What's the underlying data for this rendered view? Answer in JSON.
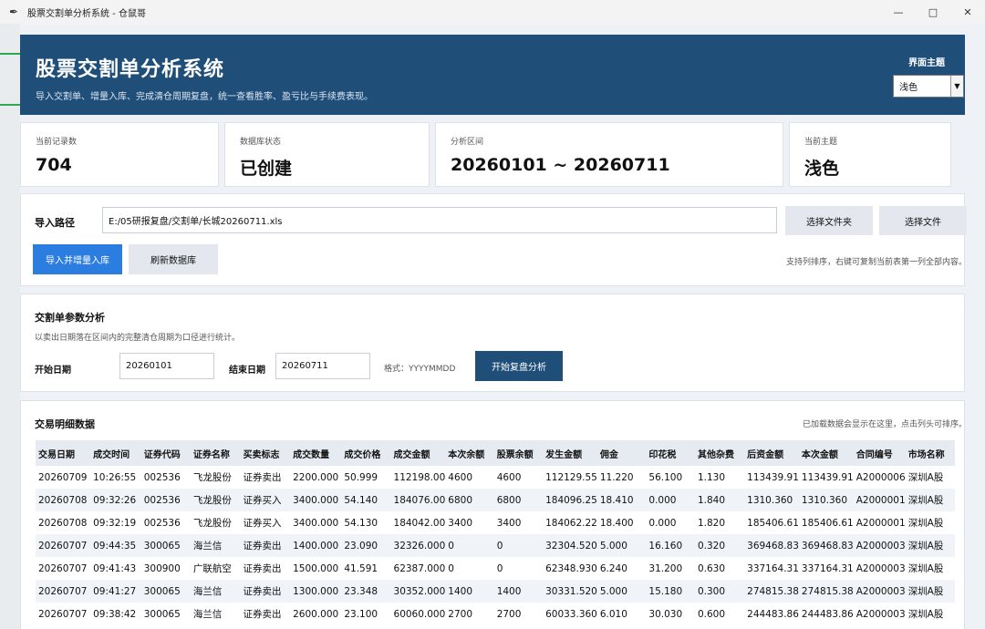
{
  "window": {
    "title": "股票交割单分析系统 - 仓鼠哥",
    "controls": [
      "minimize",
      "maximize",
      "close"
    ]
  },
  "header": {
    "title": "股票交割单分析系统",
    "subtitle": "导入交割单、增量入库、完成清仓周期复盘，统一查看胜率、盈亏比与手续费表现。",
    "theme_label": "界面主题",
    "theme_value": "浅色"
  },
  "stats": [
    {
      "label": "当前记录数",
      "value": "704"
    },
    {
      "label": "数据库状态",
      "value": "已创建"
    },
    {
      "label": "分析区间",
      "value": "20260101 ~ 20260711"
    },
    {
      "label": "当前主题",
      "value": "浅色"
    }
  ],
  "import": {
    "path_label": "导入路径",
    "path_value": "E:/05研报复盘/交割单/长城20260711.xls",
    "choose_folder": "选择文件夹",
    "choose_file": "选择文件",
    "import_button": "导入并增量入库",
    "refresh_button": "刷新数据库",
    "hint": "支持列排序，右键可复制当前表第一列全部内容。"
  },
  "analysis": {
    "title": "交割单参数分析",
    "desc": "以卖出日期落在区间内的完整清仓周期为口径进行统计。",
    "start_label": "开始日期",
    "start_value": "20260101",
    "end_label": "结束日期",
    "end_value": "20260711",
    "format_hint": "格式：YYYYMMDD",
    "run_button": "开始复盘分析"
  },
  "trades": {
    "title": "交易明细数据",
    "hint": "已加载数据会显示在这里，点击列头可排序。",
    "columns": [
      "交易日期",
      "成交时间",
      "证券代码",
      "证券名称",
      "买卖标志",
      "成交数量",
      "成交价格",
      "成交金额",
      "本次余额",
      "股票余额",
      "发生金额",
      "佣金",
      "印花税",
      "其他杂费",
      "后资金额",
      "本次金额",
      "合同编号",
      "市场名称"
    ],
    "rows": [
      [
        "20260709",
        "10:26:55",
        "002536",
        "飞龙股份",
        "证券卖出",
        "2200.000",
        "50.999",
        "112198.00",
        "4600",
        "4600",
        "112129.55",
        "11.220",
        "56.100",
        "1.130",
        "113439.91",
        "113439.91",
        "A2000006",
        "深圳A股"
      ],
      [
        "20260708",
        "09:32:26",
        "002536",
        "飞龙股份",
        "证券买入",
        "3400.000",
        "54.140",
        "184076.00",
        "6800",
        "6800",
        "184096.25",
        "18.410",
        "0.000",
        "1.840",
        "1310.360",
        "1310.360",
        "A2000001",
        "深圳A股"
      ],
      [
        "20260708",
        "09:32:19",
        "002536",
        "飞龙股份",
        "证券买入",
        "3400.000",
        "54.130",
        "184042.00",
        "3400",
        "3400",
        "184062.22",
        "18.400",
        "0.000",
        "1.820",
        "185406.61",
        "185406.61",
        "A2000001",
        "深圳A股"
      ],
      [
        "20260707",
        "09:44:35",
        "300065",
        "海兰信",
        "证券卖出",
        "1400.000",
        "23.090",
        "32326.000",
        "0",
        "0",
        "32304.520",
        "5.000",
        "16.160",
        "0.320",
        "369468.83",
        "369468.83",
        "A2000003",
        "深圳A股"
      ],
      [
        "20260707",
        "09:41:43",
        "300900",
        "广联航空",
        "证券卖出",
        "1500.000",
        "41.591",
        "62387.000",
        "0",
        "0",
        "62348.930",
        "6.240",
        "31.200",
        "0.630",
        "337164.31",
        "337164.31",
        "A2000003",
        "深圳A股"
      ],
      [
        "20260707",
        "09:41:27",
        "300065",
        "海兰信",
        "证券卖出",
        "1300.000",
        "23.348",
        "30352.000",
        "1400",
        "1400",
        "30331.520",
        "5.000",
        "15.180",
        "0.300",
        "274815.38",
        "274815.38",
        "A2000003",
        "深圳A股"
      ],
      [
        "20260707",
        "09:38:42",
        "300065",
        "海兰信",
        "证券卖出",
        "2600.000",
        "23.100",
        "60060.000",
        "2700",
        "2700",
        "60033.360",
        "6.010",
        "30.030",
        "0.600",
        "244483.86",
        "244483.86",
        "A2000003",
        "深圳A股"
      ]
    ]
  }
}
